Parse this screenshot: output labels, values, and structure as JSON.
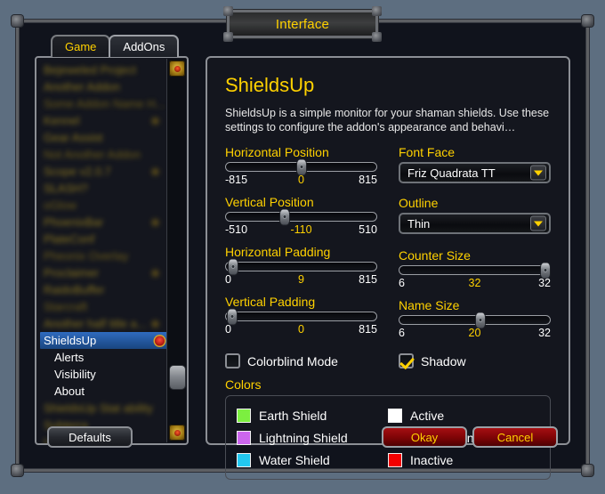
{
  "window": {
    "title": "Interface"
  },
  "tabs": [
    {
      "label": "Game",
      "active": false
    },
    {
      "label": "AddOns",
      "active": true
    }
  ],
  "addon_list": {
    "blurred_above": [
      "Bejeweled Project",
      "Another Addon",
      "Some Addon Name H...",
      "Kennel",
      "Gear Assist",
      "Not Another Addon",
      "Scope v2.0.7",
      "SLASH?",
      "oGlow",
      "PhoenixBar",
      "PlateConf",
      "Pheonix Overlay",
      "Proclaimer",
      "RaidoBuffer",
      "Starcraft",
      "Another half title a..."
    ],
    "selected": "ShieldsUp",
    "children": [
      "Alerts",
      "Visibility",
      "About"
    ],
    "blurred_below": [
      "ShieldsUp Stat ability",
      "Subterra",
      "Uno ability"
    ]
  },
  "panel": {
    "title": "ShieldsUp",
    "description": "ShieldsUp is a simple monitor for your shaman shields. Use these settings to configure the addon's appearance and behavi…"
  },
  "sliders": {
    "horizontal_position": {
      "label": "Horizontal Position",
      "min": "-815",
      "value": "0",
      "max": "815",
      "percent": 50
    },
    "vertical_position": {
      "label": "Vertical Position",
      "min": "-510",
      "value": "-110",
      "max": "510",
      "percent": 39
    },
    "horizontal_padding": {
      "label": "Horizontal Padding",
      "min": "0",
      "value": "9",
      "max": "815",
      "percent": 5
    },
    "vertical_padding": {
      "label": "Vertical Padding",
      "min": "0",
      "value": "0",
      "max": "815",
      "percent": 4
    },
    "counter_size": {
      "label": "Counter Size",
      "min": "6",
      "value": "32",
      "max": "32",
      "percent": 97
    },
    "name_size": {
      "label": "Name Size",
      "min": "6",
      "value": "20",
      "max": "32",
      "percent": 54
    }
  },
  "dropdowns": {
    "font_face": {
      "label": "Font Face",
      "value": "Friz Quadrata TT"
    },
    "outline": {
      "label": "Outline",
      "value": "Thin"
    }
  },
  "checkboxes": {
    "colorblind_mode": {
      "label": "Colorblind Mode",
      "checked": false
    },
    "shadow": {
      "label": "Shadow",
      "checked": true
    }
  },
  "colors": {
    "label": "Colors",
    "left": [
      {
        "name": "Earth Shield",
        "color": "#7CEF40"
      },
      {
        "name": "Lightning Shield",
        "color": "#CC66EE"
      },
      {
        "name": "Water Shield",
        "color": "#22C8F0"
      }
    ],
    "right": [
      {
        "name": "Active",
        "color": "#FFFFFF"
      },
      {
        "name": "Overwritten",
        "color": "#FFF000"
      },
      {
        "name": "Inactive",
        "color": "#F20000"
      }
    ]
  },
  "buttons": {
    "defaults": "Defaults",
    "okay": "Okay",
    "cancel": "Cancel"
  }
}
